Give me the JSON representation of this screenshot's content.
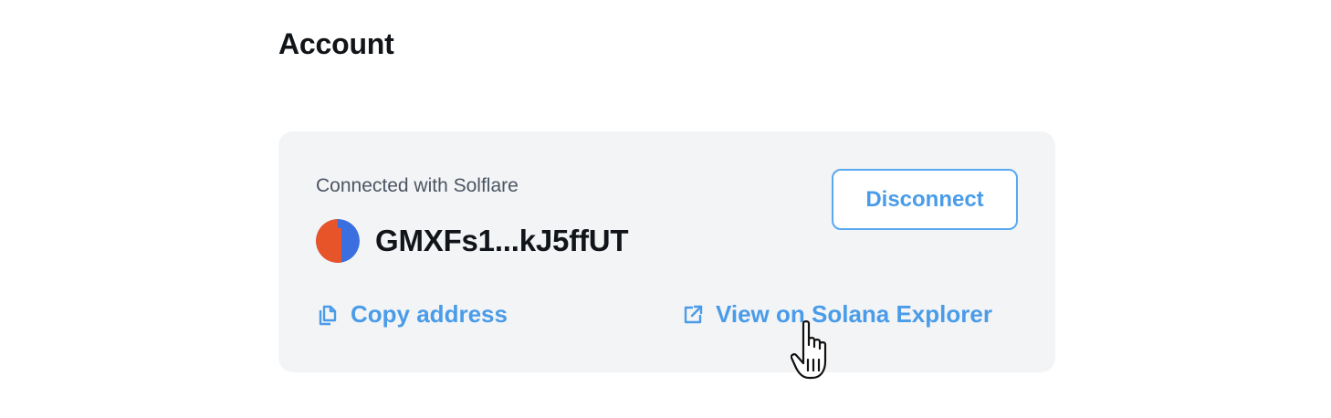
{
  "page": {
    "title": "Account"
  },
  "account": {
    "connected_label": "Connected with Solflare",
    "address_short": "GMXFs1...kJ5ffUT",
    "disconnect_label": "Disconnect",
    "copy_label": "Copy address",
    "explorer_label": "View on Solana Explorer",
    "avatar_colors": [
      "#3b6fe0",
      "#e8542a"
    ]
  },
  "icons": {
    "copy": "copy-icon",
    "external_link": "external-link-icon",
    "cursor": "hand-pointer-cursor"
  },
  "colors": {
    "accent": "#4a9ce8",
    "card_bg": "#f3f4f6",
    "title_text": "#111418",
    "muted_text": "#4c5563"
  }
}
